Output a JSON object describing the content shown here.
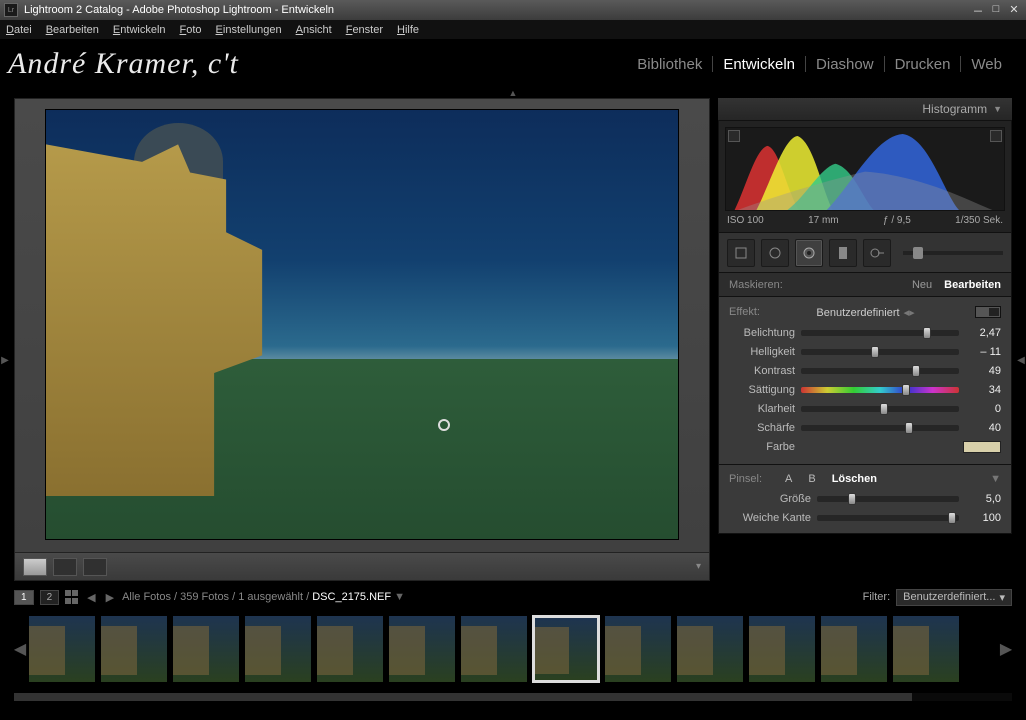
{
  "window": {
    "title": "Lightroom 2 Catalog - Adobe Photoshop Lightroom - Entwickeln",
    "app_abbrev": "Lr"
  },
  "menu": [
    "Datei",
    "Bearbeiten",
    "Entwickeln",
    "Foto",
    "Einstellungen",
    "Ansicht",
    "Fenster",
    "Hilfe"
  ],
  "identity": "André Kramer, c't",
  "modules": [
    {
      "label": "Bibliothek",
      "active": false
    },
    {
      "label": "Entwickeln",
      "active": true
    },
    {
      "label": "Diashow",
      "active": false
    },
    {
      "label": "Drucken",
      "active": false
    },
    {
      "label": "Web",
      "active": false
    }
  ],
  "histogram": {
    "title": "Histogramm",
    "meta": {
      "iso": "ISO 100",
      "focal": "17 mm",
      "aperture": "ƒ / 9,5",
      "shutter": "1/350 Sek."
    }
  },
  "mask": {
    "label": "Maskieren:",
    "new": "Neu",
    "edit": "Bearbeiten"
  },
  "effect": {
    "label": "Effekt:",
    "value": "Benutzerdefiniert"
  },
  "sliders": [
    {
      "label": "Belichtung",
      "value": "2,47",
      "pos": 77
    },
    {
      "label": "Helligkeit",
      "value": "– 11",
      "pos": 44
    },
    {
      "label": "Kontrast",
      "value": "49",
      "pos": 70
    },
    {
      "label": "Sättigung",
      "value": "34",
      "pos": 64,
      "hue": true
    },
    {
      "label": "Klarheit",
      "value": "0",
      "pos": 50
    },
    {
      "label": "Schärfe",
      "value": "40",
      "pos": 66
    }
  ],
  "color_row": {
    "label": "Farbe"
  },
  "brush": {
    "label": "Pinsel:",
    "a": "A",
    "b": "B",
    "erase": "Löschen",
    "rows": [
      {
        "label": "Größe",
        "value": "5,0",
        "pos": 22
      },
      {
        "label": "Weiche Kante",
        "value": "100",
        "pos": 92
      }
    ]
  },
  "filmstrip": {
    "modes": [
      "1",
      "2"
    ],
    "path_prefix": "Alle Fotos / 359 Fotos / 1 ausgewählt / ",
    "current": "DSC_2175.NEF",
    "filter_label": "Filter:",
    "filter_value": "Benutzerdefiniert...",
    "thumb_count": 13,
    "selected_index": 7
  }
}
